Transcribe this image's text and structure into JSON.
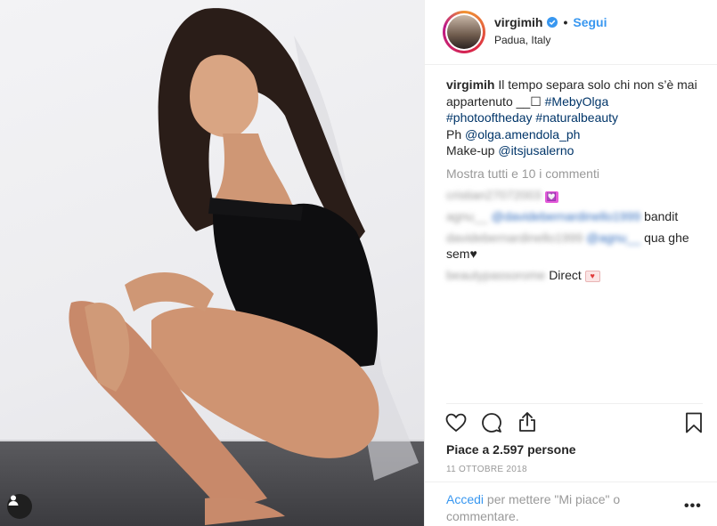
{
  "post": {
    "username": "virgimih",
    "follow_label": "Segui",
    "location": "Padua, Italy",
    "caption_text": "Il tempo separa solo chi non s’è mai appartenuto __☐",
    "caption_tag1": "#MebyOlga",
    "caption_tag2": "#photooftheday",
    "caption_tag3": "#naturalbeauty",
    "ph_label": "Ph",
    "ph_user": "@olga.amendola_ph",
    "makeup_label": "Make-up",
    "makeup_user": "@itsjusalerno",
    "show_comments": "Mostra tutti e 10 i commenti",
    "comments": [
      {
        "user": "cristian27072003",
        "text": ""
      },
      {
        "user": "agnu__",
        "mention": "@davidebernardinello1999",
        "text": "bandit"
      },
      {
        "user": "davidebernardinello1999",
        "mention": "@agnu__",
        "text": "qua ghe sem♥"
      },
      {
        "user": "beautypassorome",
        "text": "Direct"
      }
    ],
    "likes": "Piace a 2.597 persone",
    "date": "11 OTTOBRE 2018",
    "login_link": "Accedi",
    "login_text": "per mettere \"Mi piace\" o commentare.",
    "more_dots": "•••"
  },
  "icons": {
    "verified": "verified-badge-icon",
    "like": "heart-icon",
    "comment": "comment-icon",
    "share": "share-icon",
    "save": "bookmark-icon",
    "user_tag": "user-icon"
  },
  "colors": {
    "accent": "#3897f0",
    "link": "#003569",
    "muted": "#999999",
    "text": "#262626"
  }
}
